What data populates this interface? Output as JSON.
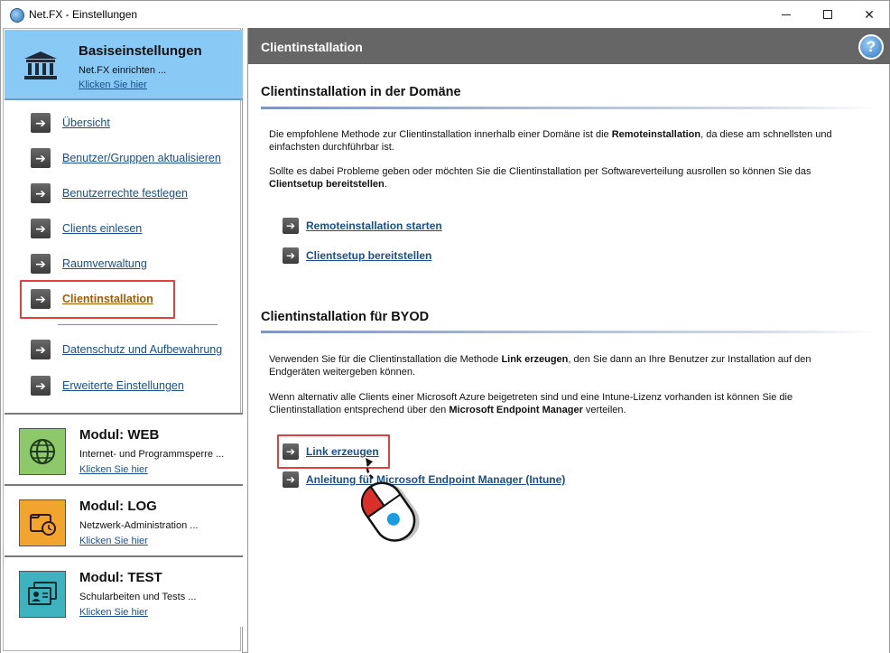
{
  "window": {
    "title": "Net.FX - Einstellungen",
    "icon": "netfx-app-icon",
    "controls": [
      "minimize",
      "maximize",
      "close"
    ]
  },
  "sidebar": {
    "base": {
      "title": "Basiseinstellungen",
      "subtitle": "Net.FX einrichten ...",
      "link": "Klicken Sie hier",
      "icon": "bank-icon",
      "background": "#89c9f6"
    },
    "items": [
      {
        "label": "Übersicht"
      },
      {
        "label": "Benutzer/Gruppen aktualisieren"
      },
      {
        "label": "Benutzerrechte festlegen"
      },
      {
        "label": "Clients einlesen"
      },
      {
        "label": "Raumverwaltung"
      },
      {
        "label": "Clientinstallation",
        "active": true
      },
      {
        "label": "Datenschutz und Aufbewahrung"
      },
      {
        "label": "Erweiterte Einstellungen"
      }
    ],
    "modules": [
      {
        "title": "Modul: WEB",
        "subtitle": "Internet- und Programmsperre ...",
        "link": "Klicken Sie hier",
        "icon": "globe-icon",
        "color": "#8dc86a"
      },
      {
        "title": "Modul: LOG",
        "subtitle": "Netzwerk-Administration ...",
        "link": "Klicken Sie hier",
        "icon": "folder-clock-icon",
        "color": "#f2a52d"
      },
      {
        "title": "Modul: TEST",
        "subtitle": "Schularbeiten und Tests ...",
        "link": "Klicken Sie hier",
        "icon": "exam-cards-icon",
        "color": "#3cb3bf"
      }
    ]
  },
  "main": {
    "header": "Clientinstallation",
    "help_icon": "?",
    "domain_section": {
      "title": "Clientinstallation in der Domäne",
      "para1_a": "Die empfohlene Methode zur Clientinstallation innerhalb einer Domäne ist die ",
      "para1_b": "Remoteinstallation",
      "para1_c": ", da diese am schnellsten und einfachsten durchführbar ist.",
      "para2_a": "Sollte es dabei Probleme geben oder möchten Sie die Clientinstallation per Softwareverteilung ausrollen so können Sie das ",
      "para2_b": "Clientsetup bereitstellen",
      "para2_c": ".",
      "actions": [
        "Remoteinstallation starten",
        "Clientsetup bereitstellen"
      ]
    },
    "byod_section": {
      "title": "Clientinstallation für BYOD",
      "para1_a": "Verwenden Sie für die Clientinstallation die Methode ",
      "para1_b": "Link erzeugen",
      "para1_c": ", den Sie dann an Ihre Benutzer zur Installation auf den Endgeräten weitergeben können.",
      "para2_a": "Wenn alternativ alle Clients einer Microsoft Azure beigetreten sind und eine Intune-Lizenz vorhanden ist können Sie die Clientinstallation entsprechend über den ",
      "para2_b": "Microsoft Endpoint Manager",
      "para2_c": " verteilen.",
      "actions": [
        "Link erzeugen",
        "Anleitung für Microsoft Endpoint Manager (Intune)"
      ]
    }
  },
  "colors": {
    "highlight": "#e0413f",
    "link": "#1a4f8a",
    "active_link": "#a35a00",
    "header_gray": "#666666"
  }
}
